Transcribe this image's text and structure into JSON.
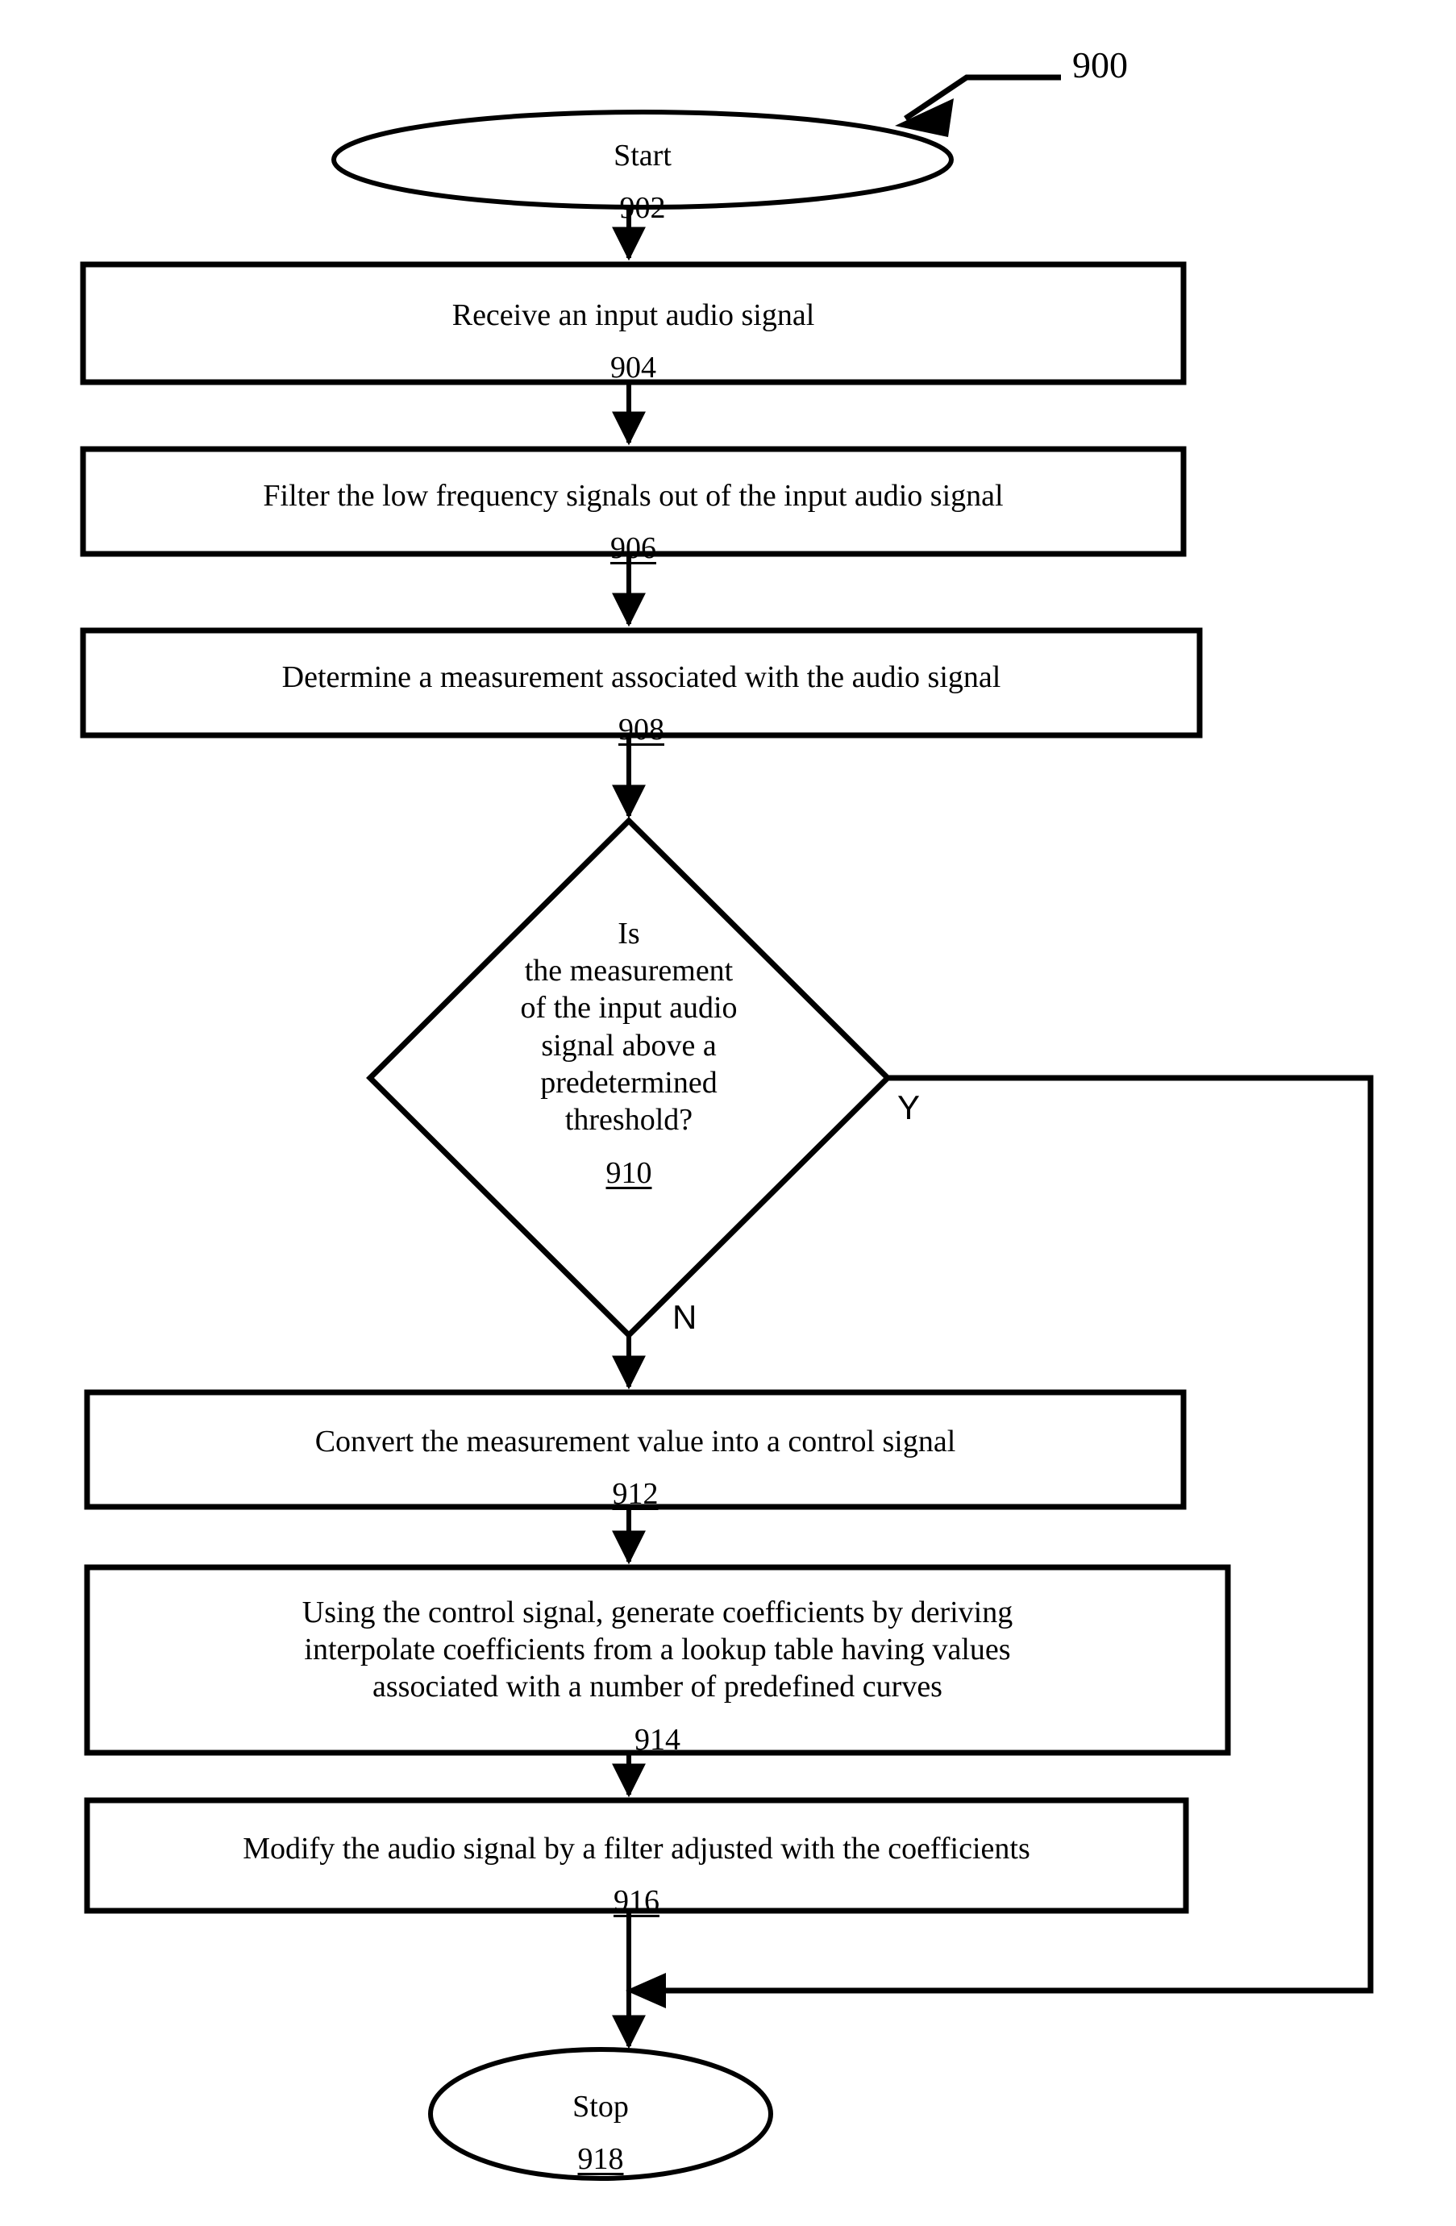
{
  "figure": {
    "number": "900",
    "leader_arrow": "figure-leader-arrow"
  },
  "flowchart": {
    "type": "flowchart",
    "nodes": [
      {
        "id": "902",
        "shape": "ellipse",
        "text": "Start",
        "ref": "902",
        "ref_underlined": false
      },
      {
        "id": "904",
        "shape": "process",
        "text": "Receive an input audio signal",
        "ref": "904",
        "ref_underlined": true
      },
      {
        "id": "906",
        "shape": "process",
        "text": "Filter the low frequency signals out of the input audio signal",
        "ref": "906",
        "ref_underlined": true
      },
      {
        "id": "908",
        "shape": "process",
        "text": "Determine a measurement associated with the audio signal",
        "ref": "908",
        "ref_underlined": true
      },
      {
        "id": "910",
        "shape": "decision",
        "text": "Is\nthe measurement\nof the input audio\nsignal above a\npredetermined\nthreshold?",
        "ref": "910",
        "ref_underlined": true
      },
      {
        "id": "912",
        "shape": "process",
        "text": "Convert the measurement value into a control signal",
        "ref": "912",
        "ref_underlined": true
      },
      {
        "id": "914",
        "shape": "process",
        "text": "Using the control signal, generate coefficients by deriving\ninterpolate coefficients from a lookup table having values\nassociated with a number of predefined curves",
        "ref": "914",
        "ref_underlined": false
      },
      {
        "id": "916",
        "shape": "process",
        "text": "Modify the audio signal by a filter adjusted with the coefficients",
        "ref": "916",
        "ref_underlined": true
      },
      {
        "id": "918",
        "shape": "ellipse",
        "text": "Stop",
        "ref": "918",
        "ref_underlined": true
      }
    ],
    "edges": [
      {
        "from": "902",
        "to": "904",
        "label": ""
      },
      {
        "from": "904",
        "to": "906",
        "label": ""
      },
      {
        "from": "906",
        "to": "908",
        "label": ""
      },
      {
        "from": "908",
        "to": "910",
        "label": ""
      },
      {
        "from": "910",
        "to": "912",
        "label": "N"
      },
      {
        "from": "910",
        "to": "918",
        "label": "Y"
      },
      {
        "from": "912",
        "to": "914",
        "label": ""
      },
      {
        "from": "914",
        "to": "916",
        "label": ""
      },
      {
        "from": "916",
        "to": "918",
        "label": ""
      }
    ],
    "branch_labels": {
      "yes": "Y",
      "no": "N"
    }
  },
  "colors": {
    "stroke": "#000000",
    "fill": "#ffffff",
    "text": "#000000"
  }
}
